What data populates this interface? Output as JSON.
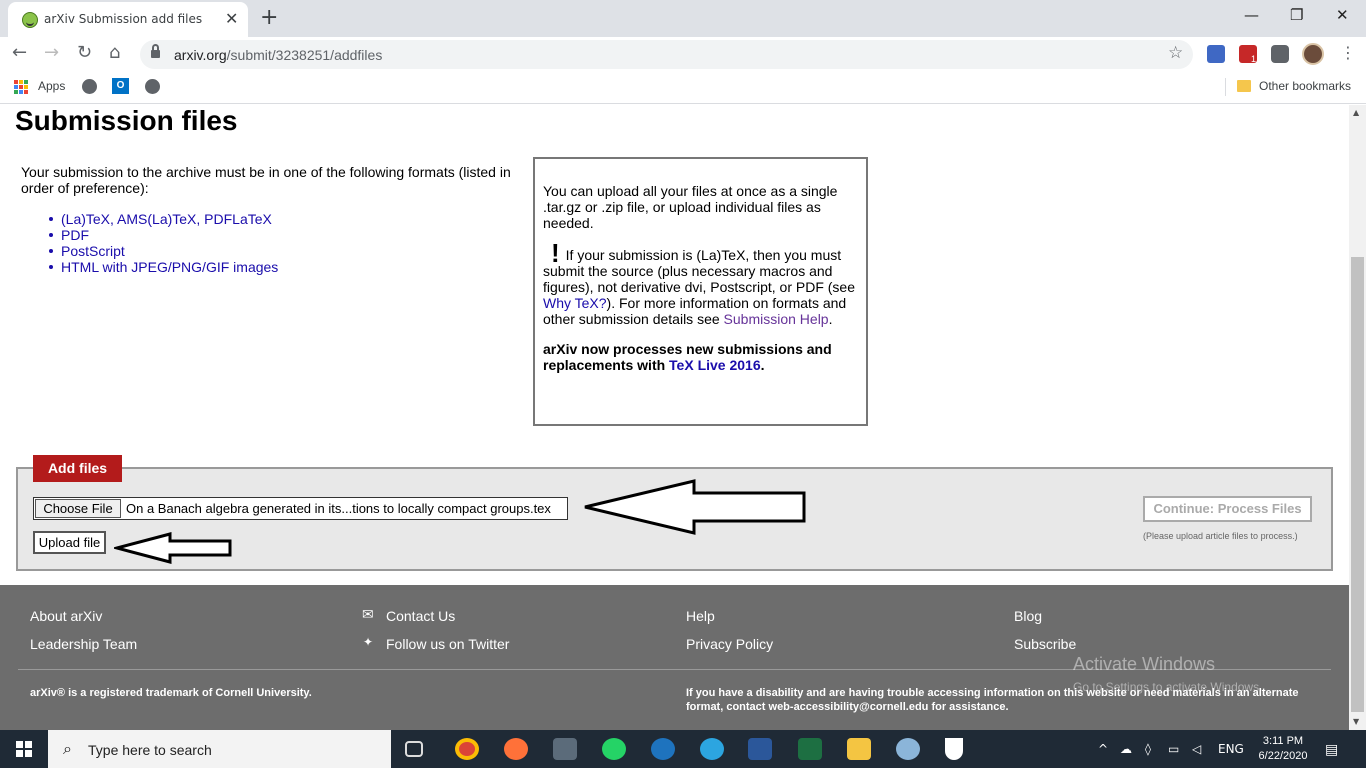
{
  "browser": {
    "tab_title": "arXiv Submission add files",
    "tab_close": "✕",
    "new_tab": "+",
    "window_controls": {
      "minimize": "—",
      "maximize": "❐",
      "close": "✕"
    },
    "nav": {
      "back": "←",
      "forward": "→",
      "reload": "↻",
      "home": "⌂"
    },
    "url_host": "arxiv.org",
    "url_path": "/submit/3238251/addfiles",
    "star": "☆",
    "menu": "⋮",
    "extension_badge": "1",
    "bookmarks": {
      "apps": "Apps",
      "other": "Other bookmarks"
    }
  },
  "page": {
    "title": "Submission files",
    "formats_intro": "Your submission to the archive must be in one of the following formats (listed in order of preference):",
    "formats": [
      "(La)TeX, AMS(La)TeX, PDFLaTeX",
      "PDF",
      "PostScript",
      "HTML with JPEG/PNG/GIF images"
    ],
    "info": {
      "p1": "You can upload all your files at once as a single .tar.gz or .zip file, or upload individual files as needed.",
      "excl": "!",
      "p2_start": "If your submission is (La)TeX, then you must submit the source (plus necessary macros and figures), not derivative dvi, Postscript, or PDF (see ",
      "why_tex": "Why TeX?",
      "p2_mid": "). For more information on formats and other submission details see ",
      "submission_help": "Submission Help",
      "p2_end": ".",
      "p3_start": "arXiv now processes new submissions and replacements with ",
      "texlive": "TeX Live 2016",
      "p3_end": "."
    },
    "add_files": {
      "legend": "Add files",
      "choose_file": "Choose File",
      "file_name": "On a Banach algebra generated in its...tions to locally compact groups.tex",
      "upload": "Upload file",
      "continue": "Continue: Process Files",
      "continue_note": "(Please upload article files to process.)"
    }
  },
  "footer": {
    "col1": [
      "About arXiv",
      "Leadership Team"
    ],
    "col2": [
      "Contact Us",
      "Follow us on Twitter"
    ],
    "col3": [
      "Help",
      "Privacy Policy"
    ],
    "col4": [
      "Blog",
      "Subscribe"
    ],
    "trademark": "arXiv® is a registered trademark of Cornell University.",
    "accessibility": "If you have a disability and are having trouble accessing information on this website or need materials in an alternate format, contact web-accessibility@cornell.edu for assistance.",
    "watermark_title": "Activate Windows",
    "watermark_sub": "Go to Settings to activate Windows."
  },
  "taskbar": {
    "search_placeholder": "Type here to search",
    "lang": "ENG",
    "time": "3:11 PM",
    "date": "6/22/2020"
  },
  "colors": {
    "arxiv_red": "#b31b1b",
    "footer_gray": "#6d6d6d",
    "link_blue": "#1a0dab",
    "taskbar": "#1f2a36"
  }
}
